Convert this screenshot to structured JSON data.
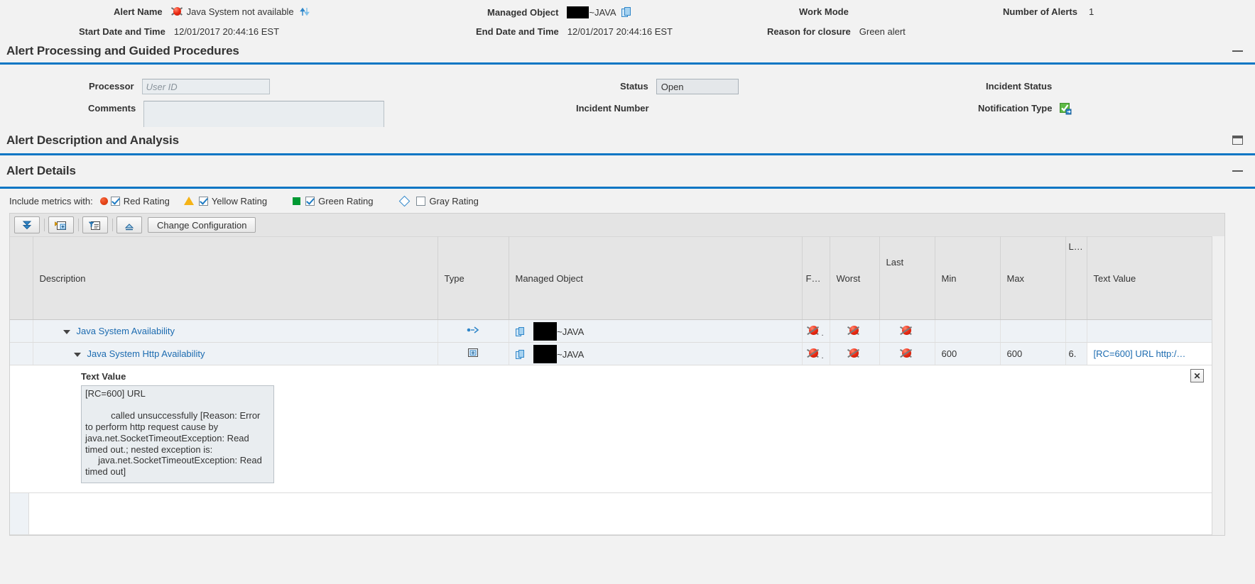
{
  "header": {
    "alert_name_label": "Alert Name",
    "alert_name_value": "Java System not available",
    "alert_name_icon": "red-alert-icon",
    "alert_sort_icon": "sort-updown-icon",
    "start_date_label": "Start Date and Time",
    "start_date_value": "12/01/2017 20:44:16 EST",
    "managed_object_label": "Managed Object",
    "managed_object_value": "~JAVA",
    "managed_object_icon": "managed-object-icon",
    "end_date_label": "End Date and Time",
    "end_date_value": "12/01/2017 20:44:16 EST",
    "work_mode_label": "Work Mode",
    "work_mode_value": "",
    "reason_for_closure_label": "Reason for closure",
    "reason_for_closure_value": "Green alert",
    "number_of_alerts_label": "Number of Alerts",
    "number_of_alerts_value": "1"
  },
  "processing_section": {
    "title": "Alert Processing and Guided Procedures",
    "collapse_icon": "minimize-icon",
    "processor_label": "Processor",
    "processor_value": "",
    "processor_placeholder": "User ID",
    "comments_label": "Comments",
    "comments_value": "",
    "status_label": "Status",
    "status_value": "Open",
    "incident_number_label": "Incident Number",
    "incident_number_value": "",
    "incident_status_label": "Incident Status",
    "incident_status_value": "",
    "notification_type_label": "Notification Type",
    "notification_type_icon": "green-check-notification-icon"
  },
  "description_section": {
    "title": "Alert Description and Analysis",
    "collapse_icon": "restore-icon"
  },
  "details_section": {
    "title": "Alert Details",
    "collapse_icon": "minimize-icon",
    "include_metrics_label": "Include metrics with:",
    "rating_filters": [
      {
        "label": "Red Rating",
        "checked": true,
        "shape": "circle",
        "color": "#e8471c",
        "name": "red-rating"
      },
      {
        "label": "Yellow Rating",
        "checked": true,
        "shape": "triangle",
        "color": "#f5b316",
        "name": "yellow-rating"
      },
      {
        "label": "Green Rating",
        "checked": true,
        "shape": "square",
        "color": "#009933",
        "name": "green-rating"
      },
      {
        "label": "Gray Rating",
        "checked": false,
        "shape": "diamond",
        "color": "#2f86c9",
        "name": "gray-rating"
      }
    ],
    "toolbar": {
      "expand_all_icon": "expand-all-icon",
      "add_column_icon": "add-column-icon",
      "filter_icon": "filter-icon",
      "collapse_all_icon": "collapse-all-icon",
      "change_configuration_label": "Change Configuration"
    },
    "columns": [
      {
        "key": "description",
        "label": "Description"
      },
      {
        "key": "type",
        "label": "Type"
      },
      {
        "key": "managed_object",
        "label": "Managed Object"
      },
      {
        "key": "f",
        "label": "F…"
      },
      {
        "key": "worst",
        "label": "Worst"
      },
      {
        "key": "last",
        "label": "Last"
      },
      {
        "key": "min",
        "label": "Min"
      },
      {
        "key": "max",
        "label": "Max"
      },
      {
        "key": "l",
        "label": "L…"
      },
      {
        "key": "text_value",
        "label": "Text Value"
      }
    ],
    "rows": [
      {
        "description": "Java System Availability",
        "indent": 0,
        "expanded": true,
        "type_icon": "metric-group-icon",
        "managed_object": "~JAVA",
        "f_rating": "red",
        "worst_rating": "red",
        "last_rating": "red",
        "min": "",
        "max": "",
        "l": "",
        "text_value": ""
      },
      {
        "description": "Java System Http Availability",
        "indent": 1,
        "expanded": true,
        "type_icon": "metric-item-icon",
        "managed_object": "~JAVA",
        "f_rating": "red",
        "worst_rating": "red",
        "last_rating": "red",
        "min": "600",
        "max": "600",
        "l": "6.",
        "text_value": "[RC=600] URL http:/…"
      }
    ],
    "detail_panel": {
      "label": "Text Value",
      "value": "[RC=600] URL \n\n          called unsuccessfully [Reason: Error to perform http request cause by java.net.SocketTimeoutException: Read timed out.; nested exception is:\n     java.net.SocketTimeoutException: Read timed out]",
      "close_icon": "close-icon"
    }
  },
  "colors": {
    "accent_blue": "#0a76c4",
    "link_blue": "#1c6bb0",
    "page_bg": "#f2f2f2",
    "row_bg": "#eef2f6",
    "header_bg": "#e5e5e5",
    "red": "#e8471c",
    "yellow": "#f5b316",
    "green": "#009933"
  }
}
